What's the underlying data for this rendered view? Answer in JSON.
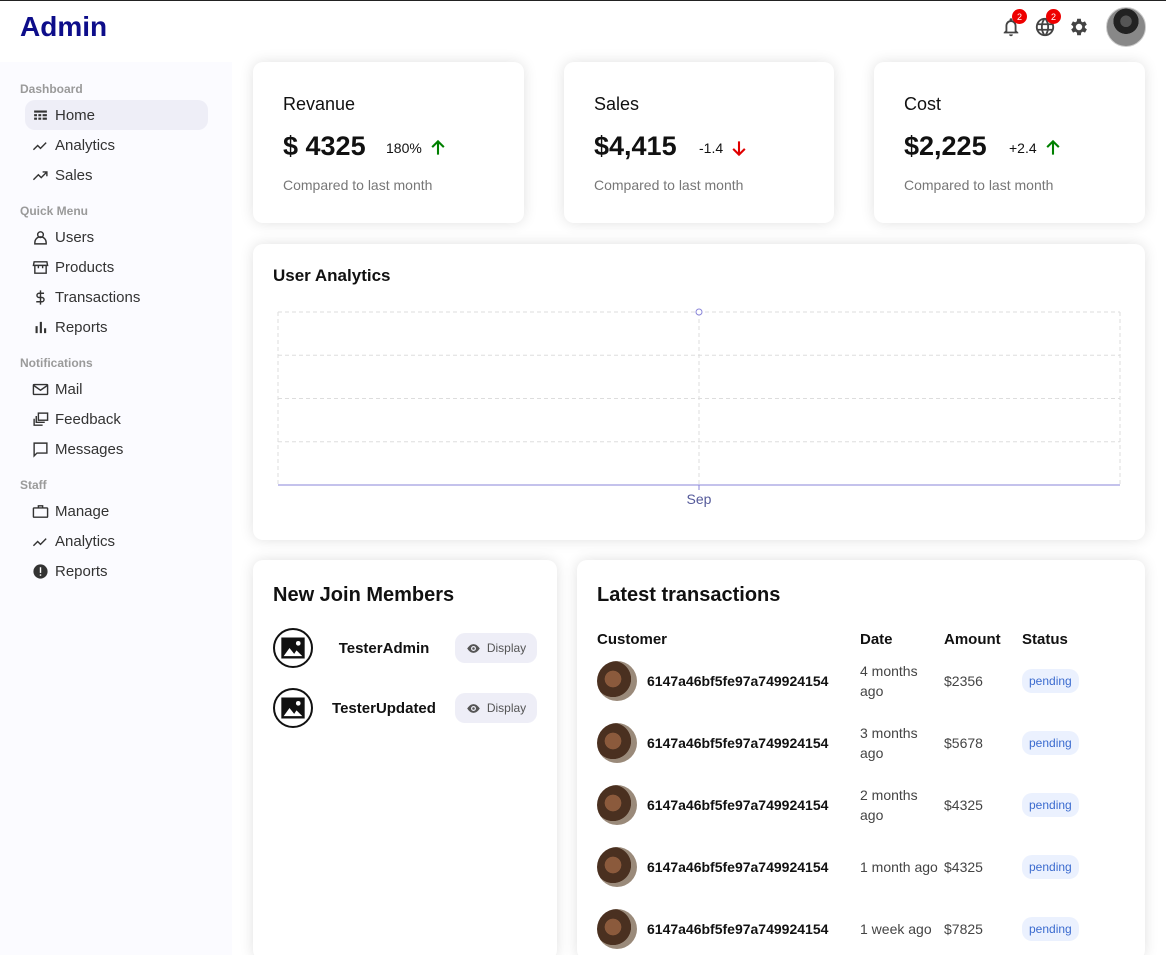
{
  "header": {
    "logo": "Admin",
    "notification_badge": "2",
    "language_badge": "2"
  },
  "sidebar": {
    "sections": [
      {
        "title": "Dashboard",
        "items": [
          {
            "label": "Home",
            "icon": "dashboard-icon",
            "active": true
          },
          {
            "label": "Analytics",
            "icon": "timeline-icon"
          },
          {
            "label": "Sales",
            "icon": "trending-up-icon"
          }
        ]
      },
      {
        "title": "Quick Menu",
        "items": [
          {
            "label": "Users",
            "icon": "person-icon"
          },
          {
            "label": "Products",
            "icon": "storefront-icon"
          },
          {
            "label": "Transactions",
            "icon": "dollar-icon"
          },
          {
            "label": "Reports",
            "icon": "bar-chart-icon"
          }
        ]
      },
      {
        "title": "Notifications",
        "items": [
          {
            "label": "Mail",
            "icon": "mail-icon"
          },
          {
            "label": "Feedback",
            "icon": "dynamic-feed-icon"
          },
          {
            "label": "Messages",
            "icon": "chat-bubble-icon"
          }
        ]
      },
      {
        "title": "Staff",
        "items": [
          {
            "label": "Manage",
            "icon": "work-icon"
          },
          {
            "label": "Analytics",
            "icon": "timeline-icon"
          },
          {
            "label": "Reports",
            "icon": "report-icon"
          }
        ]
      }
    ]
  },
  "featured": [
    {
      "title": "Revanue",
      "money": "$ 4325",
      "rate": "180%",
      "trend": "up",
      "sub": "Compared to last month"
    },
    {
      "title": "Sales",
      "money": "$4,415",
      "rate": "-1.4",
      "trend": "down",
      "sub": "Compared to last month"
    },
    {
      "title": "Cost",
      "money": "$2,225",
      "rate": "+2.4",
      "trend": "up",
      "sub": "Compared to last month"
    }
  ],
  "colors": {
    "up": "#008000",
    "down": "#e00000",
    "brand": "#0d0d8a",
    "chart_line": "#8884d8"
  },
  "chart": {
    "title": "User Analytics",
    "chart_data": {
      "type": "line",
      "x": [
        "Sep"
      ],
      "series": [
        {
          "values": [
            1
          ]
        }
      ],
      "grid": true
    }
  },
  "members": {
    "title": "New Join Members",
    "items": [
      {
        "name": "TesterAdmin",
        "button": "Display"
      },
      {
        "name": "TesterUpdated",
        "button": "Display"
      }
    ]
  },
  "transactions": {
    "title": "Latest transactions",
    "headers": [
      "Customer",
      "Date",
      "Amount",
      "Status"
    ],
    "rows": [
      {
        "customer": "6147a46bf5fe97a749924154",
        "date": "4 months ago",
        "amount": "$2356",
        "status": "pending"
      },
      {
        "customer": "6147a46bf5fe97a749924154",
        "date": "3 months ago",
        "amount": "$5678",
        "status": "pending"
      },
      {
        "customer": "6147a46bf5fe97a749924154",
        "date": "2 months ago",
        "amount": "$4325",
        "status": "pending"
      },
      {
        "customer": "6147a46bf5fe97a749924154",
        "date": "1 month ago",
        "amount": "$4325",
        "status": "pending"
      },
      {
        "customer": "6147a46bf5fe97a749924154",
        "date": "1 week ago",
        "amount": "$7825",
        "status": "pending"
      }
    ]
  }
}
